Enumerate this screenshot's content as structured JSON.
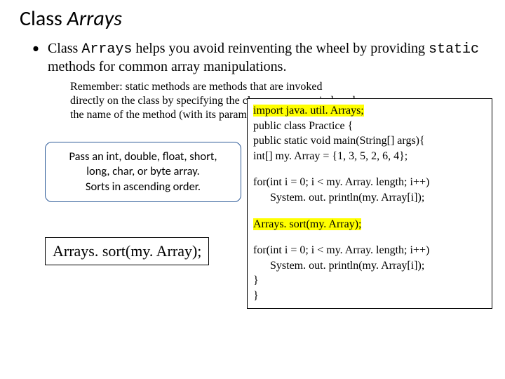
{
  "title": {
    "plain": "Class ",
    "ital": "Arrays"
  },
  "bullet": {
    "pre": "Class ",
    "code1": "Arrays",
    "mid": " helps you avoid reinventing the wheel by providing ",
    "code2": "static",
    "post": " methods for common array manipulations."
  },
  "remember": "Remember: static methods are methods that are invoked directly on the class by specifying the class name, a period, and the name of the method (with its parameters).",
  "callout": {
    "l1": "Pass an int, double, float, short,",
    "l2": "long, char, or byte array.",
    "l3": "Sorts in ascending order."
  },
  "sortbox": "Arrays. sort(my. Array);",
  "code": {
    "l1": "import java. util. Arrays;",
    "l2": "public class Practice {",
    "l3": "public static void main(String[] args){",
    "l4": "int[] my. Array = {1, 3, 5, 2, 6, 4};",
    "l5": "for(int i = 0; i < my. Array. length; i++)",
    "l6": "System. out. println(my. Array[i]);",
    "l7": "Arrays. sort(my. Array);",
    "l8": "for(int i = 0; i < my. Array. length; i++)",
    "l9": "System. out. println(my. Array[i]);",
    "l10": "}",
    "l11": "}"
  }
}
